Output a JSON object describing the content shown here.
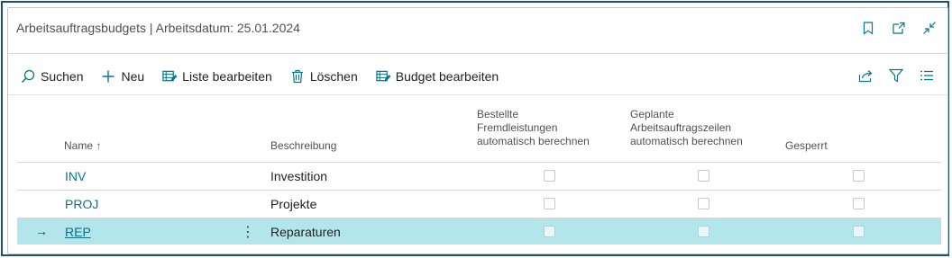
{
  "window": {
    "title": "Arbeitsauftragsbudgets | Arbeitsdatum: 25.01.2024",
    "icons": [
      "bookmark-icon",
      "open-new-window-icon",
      "collapse-icon"
    ]
  },
  "toolbar": {
    "search_label": "Suchen",
    "new_label": "Neu",
    "edit_list_label": "Liste bearbeiten",
    "delete_label": "Löschen",
    "edit_budget_label": "Budget bearbeiten",
    "right_icons": [
      "share-icon",
      "filter-icon",
      "list-view-icon"
    ]
  },
  "table": {
    "headers": {
      "name": "Name ↑",
      "description": "Beschreibung",
      "ordered_line1": "Bestellte",
      "ordered_line2": "Fremdleistungen",
      "ordered_line3": "automatisch berechnen",
      "planned_line1": "Geplante",
      "planned_line2": "Arbeitsauftragszeilen",
      "planned_line3": "automatisch berechnen",
      "blocked": "Gesperrt"
    },
    "rows": [
      {
        "name": "INV",
        "description": "Investition",
        "ordered_auto": false,
        "planned_auto": false,
        "blocked": false,
        "selected": false
      },
      {
        "name": "PROJ",
        "description": "Projekte",
        "ordered_auto": false,
        "planned_auto": false,
        "blocked": false,
        "selected": false
      },
      {
        "name": "REP",
        "description": "Reparaturen",
        "ordered_auto": false,
        "planned_auto": false,
        "blocked": false,
        "selected": true,
        "row_marker": "→",
        "more_menu": "⋮"
      }
    ]
  },
  "colors": {
    "accent": "#00788f",
    "selected_row": "#b2e6ea",
    "frame_border": "#1f4e79"
  }
}
